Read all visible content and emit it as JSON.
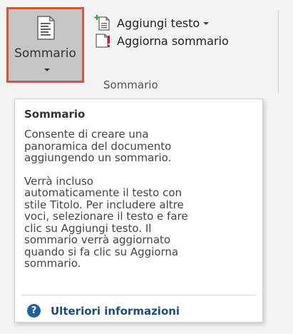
{
  "ribbon": {
    "toc_button_label": "Sommario",
    "add_text_label": "Aggiungi testo",
    "update_table_label": "Aggiorna sommario",
    "group_label": "Sommario"
  },
  "tooltip": {
    "title": "Sommario",
    "paragraph1": "Consente di creare una\npanoramica del documento\naggiungendo un sommario.",
    "paragraph2": "Verrà incluso\nautomaticamente il testo con\nstile Titolo. Per includere altre\nvoci, selezionare il testo e fare\nclic su Aggiungi testo. Il\nsommario verrà aggiornato\nquando si fa clic su Aggiorna\nsommario.",
    "help_link": "Ulteriori informazioni",
    "help_icon_text": "?"
  },
  "colors": {
    "selected_border": "#d8523d",
    "selected_fill": "#c6c6c6",
    "help_link": "#1b4c7f",
    "warning_red": "#d31f1f"
  },
  "icons": {
    "toc_button": "table-of-contents-icon",
    "add_text": "add-text-icon",
    "update_table": "update-table-icon",
    "help": "help-icon",
    "dropdown": "chevron-down-icon"
  }
}
